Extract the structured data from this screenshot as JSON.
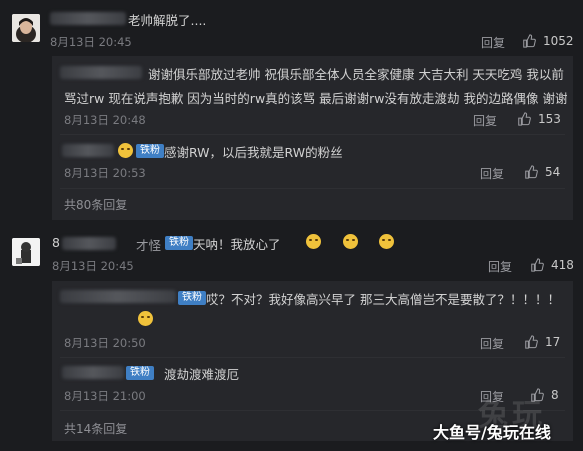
{
  "comment1": {
    "text": "老帅解脱了....",
    "date": "8月13日 20:45",
    "reply": "回复",
    "likes": "1052",
    "replies": [
      {
        "text_line1": "谢谢俱乐部放过老帅  祝俱乐部全体人员全家健康  大吉大利  天天吃鸡  我以前",
        "text_line2": "骂过rw  现在说声抱歉  因为当时的rw真的该骂  最后谢谢rw没有放走渡劫  我的边路偶像  谢谢",
        "date": "8月13日 20:48",
        "reply": "回复",
        "likes": "153"
      },
      {
        "badge": "铁粉",
        "text": "感谢RW，以后我就是RW的粉丝",
        "date": "8月13日 20:53",
        "reply": "回复",
        "likes": "54"
      }
    ],
    "more": "共80条回复"
  },
  "comment2": {
    "username_prefix": "8",
    "username_suffix": "才怪",
    "badge": "铁粉",
    "text": "天呐！我放心了",
    "date": "8月13日 20:45",
    "reply": "回复",
    "likes": "418",
    "replies": [
      {
        "badge": "铁粉",
        "text": "哎？不对？我好像高兴早了  那三大高僧岂不是要散了？！！！！",
        "date": "8月13日 20:50",
        "reply": "回复",
        "likes": "17"
      },
      {
        "badge": "铁粉",
        "text": "渡劫渡难渡厄",
        "date": "8月13日 21:00",
        "reply": "回复",
        "likes": "8"
      }
    ],
    "more": "共14条回复"
  },
  "watermark": {
    "big": "兔玩",
    "text": "大鱼号/兔玩在线"
  },
  "icons": [
    "thumbs-up-icon",
    "emoji-icon"
  ]
}
